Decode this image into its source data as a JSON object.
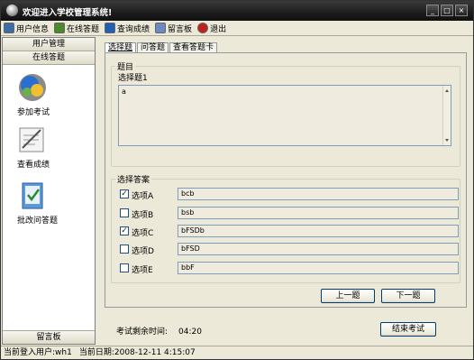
{
  "window": {
    "title": "欢迎进入学校管理系统!"
  },
  "toolbar": {
    "items": [
      {
        "label": "用户信息",
        "icon": "user-info-icon",
        "color": "#3a6ea5"
      },
      {
        "label": "在线答题",
        "icon": "online-exam-icon",
        "color": "#4a8a2a"
      },
      {
        "label": "查询成绩",
        "icon": "query-grades-icon",
        "color": "#2060b0"
      },
      {
        "label": "留言板",
        "icon": "message-board-icon",
        "color": "#6a8ac0"
      },
      {
        "label": "退出",
        "icon": "exit-icon",
        "color": "#c02020"
      }
    ]
  },
  "sidebar": {
    "header1": "用户管理",
    "header2": "在线答题",
    "items": [
      {
        "label": "参加考试",
        "icon": "take-exam-icon"
      },
      {
        "label": "查看成绩",
        "icon": "view-grades-icon"
      },
      {
        "label": "批改问答题",
        "icon": "grade-essay-icon"
      }
    ],
    "footer": "留言板"
  },
  "tabs": [
    {
      "label": "选择题",
      "active": true
    },
    {
      "label": "问答题",
      "active": false
    },
    {
      "label": "查看答题卡",
      "active": false
    }
  ],
  "question": {
    "group_title": "题目",
    "label": "选择题1",
    "text": "a"
  },
  "answers": {
    "group_title": "选择答案",
    "options": [
      {
        "label": "选项A",
        "value": "bcb",
        "checked": true
      },
      {
        "label": "选项B",
        "value": "bsb",
        "checked": false
      },
      {
        "label": "选项C",
        "value": "bFSDb",
        "checked": true
      },
      {
        "label": "选项D",
        "value": "bFSD",
        "checked": false
      },
      {
        "label": "选项E",
        "value": "bbF",
        "checked": false
      }
    ]
  },
  "buttons": {
    "prev": "上一题",
    "next": "下一题",
    "finish": "结束考试"
  },
  "timer": {
    "label": "考试剩余时间:",
    "value": "04:20"
  },
  "status": {
    "user": "当前登入用户:wh1",
    "date": "当前日期:2008-12-11 4:15:07"
  }
}
